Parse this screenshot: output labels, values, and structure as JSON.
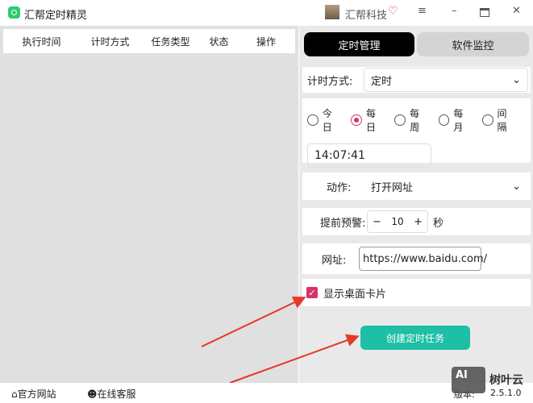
{
  "app": {
    "title": "汇帮定时精灵",
    "user": "汇帮科技"
  },
  "table": {
    "headers": [
      "执行时间",
      "计时方式",
      "任务类型",
      "状态",
      "操作"
    ]
  },
  "tabs": [
    "定时管理",
    "软件监控"
  ],
  "timing": {
    "label": "计时方式:",
    "value": "定时"
  },
  "frequency": {
    "options": [
      "今日",
      "每日",
      "每周",
      "每月",
      "间隔"
    ],
    "selected": "每日"
  },
  "time_value": "14:07:41",
  "action": {
    "label": "动作:",
    "value": "打开网址"
  },
  "warning": {
    "label": "提前预警:",
    "value": "10",
    "unit": "秒",
    "minus": "−",
    "plus": "+"
  },
  "url": {
    "label": "网址:",
    "value": "https://www.baidu.com/"
  },
  "show_card": {
    "label": "显示桌面卡片",
    "checked": true
  },
  "create_button": "创建定时任务",
  "footer": {
    "website": "官方网站",
    "support": "在线客服",
    "version_label": "版本:",
    "version": "2.5.1.0"
  },
  "watermark": "AI 树叶云"
}
